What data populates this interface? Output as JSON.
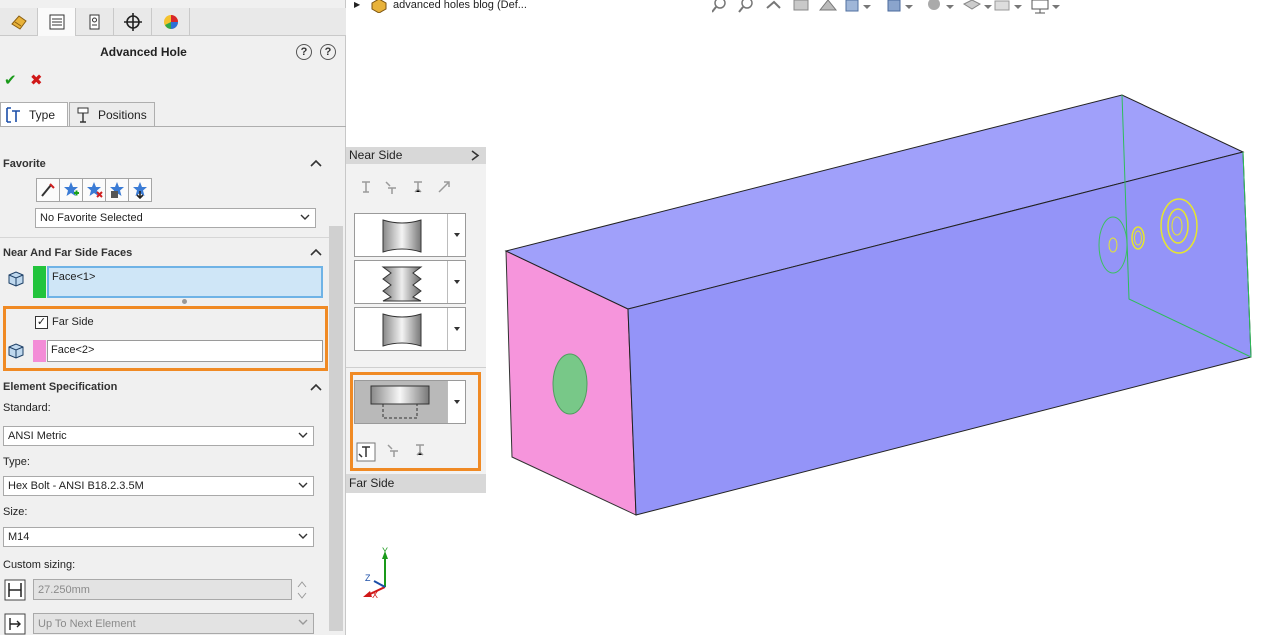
{
  "property_manager": {
    "tab_icons": [
      "feature-manager-icon",
      "property-manager-icon",
      "configuration-manager-icon",
      "dimxpert-icon",
      "display-manager-icon"
    ],
    "title": "Advanced Hole",
    "help_icons": [
      "help-whats-new-icon",
      "help-icon"
    ],
    "sub_tabs": {
      "type": "Type",
      "positions": "Positions"
    },
    "favorite": {
      "header": "Favorite",
      "icons": [
        "apply-defaults-icon",
        "add-favorite-icon",
        "delete-favorite-icon",
        "save-favorite-icon",
        "load-favorite-icon"
      ],
      "selected": "No Favorite Selected"
    },
    "faces": {
      "header": "Near And Far Side Faces",
      "near_face": "Face<1>",
      "near_color": "#22c43c",
      "far_side_label": "Far Side",
      "far_side_checked": true,
      "far_face": "Face<2>",
      "far_color": "#f38dd7"
    },
    "element_spec": {
      "header": "Element Specification",
      "standard_label": "Standard:",
      "standard_value": "ANSI Metric",
      "type_label": "Type:",
      "type_value": "Hex Bolt - ANSI B18.2.3.5M",
      "size_label": "Size:",
      "size_value": "M14",
      "custom_label": "Custom sizing:",
      "custom_value": "27.250mm",
      "end_condition": "Up To Next Element"
    }
  },
  "near_side_panel": {
    "header": "Near Side",
    "footer": "Far Side"
  },
  "graphics": {
    "tree_item": "advanced holes blog  (Def...",
    "heads_up_icons": [
      "zoom-to-fit-icon",
      "zoom-to-area-icon",
      "previous-view-icon",
      "section-view-icon",
      "dynamic-annotation-icon",
      "view-orientation-icon",
      "display-style-icon",
      "hide-show-icon",
      "edit-appearance-icon",
      "apply-scene-icon",
      "view-settings-icon"
    ],
    "triad_axes": [
      "Y",
      "Z",
      "X"
    ],
    "colors": {
      "body_face": "#9494f8",
      "body_top": "#a0a0fa",
      "near_face": "#f695dc",
      "hole": "#78c888",
      "hole_outline_far": "#e6e62e",
      "accent_orange": "#f08a24"
    }
  }
}
